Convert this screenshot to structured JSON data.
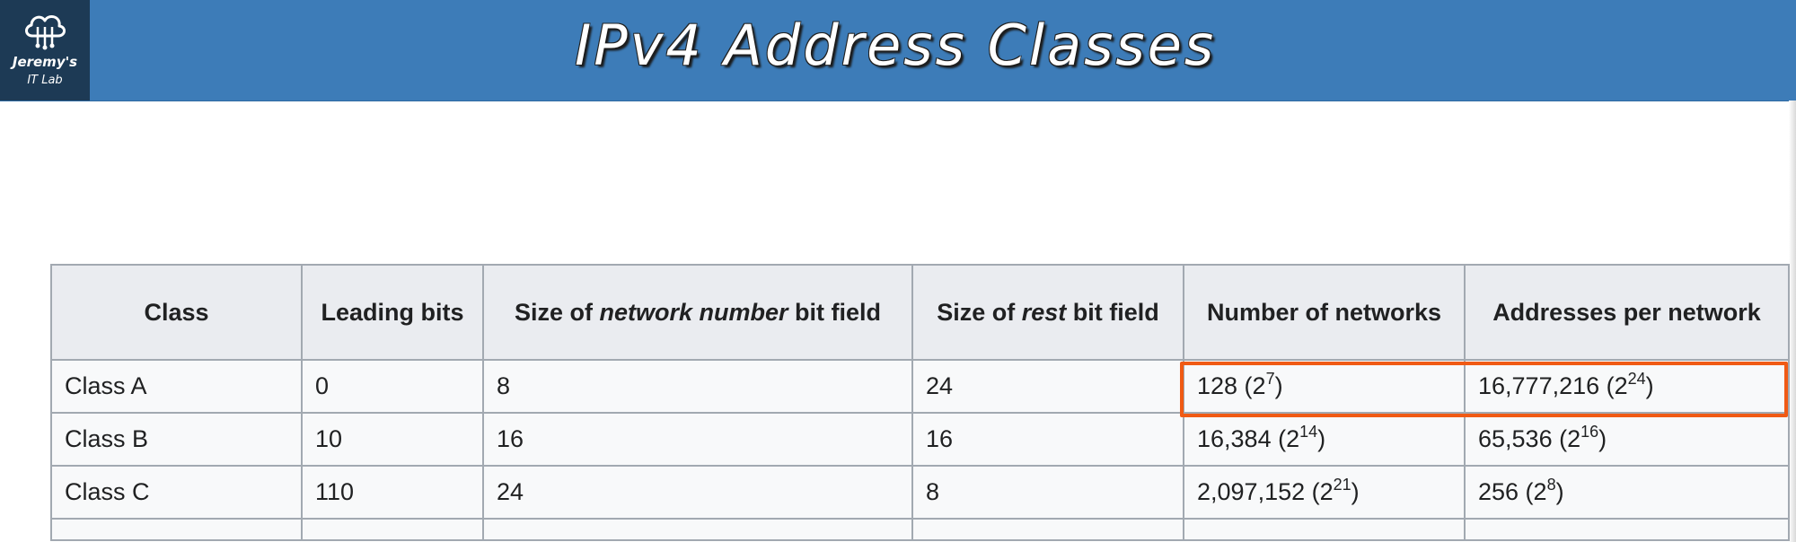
{
  "slide": {
    "title": "IPv4 Address Classes",
    "logo_line1": "Jeremy's",
    "logo_line2": "IT Lab",
    "logo_icon": "cloud-circuit-icon",
    "banner_color": "#3d7cb8",
    "logo_bg_color": "#1d3a55",
    "highlight_color": "#f05a14"
  },
  "table": {
    "headers": [
      {
        "pre": "Class",
        "em": "",
        "post": ""
      },
      {
        "pre": "Leading bits",
        "em": "",
        "post": ""
      },
      {
        "pre": "Size of ",
        "em": "network number",
        "post": " bit field"
      },
      {
        "pre": "Size of ",
        "em": "rest",
        "post": " bit field"
      },
      {
        "pre": "Number of networks",
        "em": "",
        "post": ""
      },
      {
        "pre": "Addresses per network",
        "em": "",
        "post": ""
      }
    ],
    "rows": [
      {
        "class": "Class A",
        "leading_bits": "0",
        "network_bits": "8",
        "rest_bits": "24",
        "networks": {
          "value": "128 (2",
          "exp": "7",
          "close": ")"
        },
        "addresses": {
          "value": "16,777,216 (2",
          "exp": "24",
          "close": ")"
        }
      },
      {
        "class": "Class B",
        "leading_bits": "10",
        "network_bits": "16",
        "rest_bits": "16",
        "networks": {
          "value": "16,384 (2",
          "exp": "14",
          "close": ")"
        },
        "addresses": {
          "value": "65,536 (2",
          "exp": "16",
          "close": ")"
        }
      },
      {
        "class": "Class C",
        "leading_bits": "110",
        "network_bits": "24",
        "rest_bits": "8",
        "networks": {
          "value": "2,097,152 (2",
          "exp": "21",
          "close": ")"
        },
        "addresses": {
          "value": "256 (2",
          "exp": "8",
          "close": ")"
        }
      }
    ]
  }
}
